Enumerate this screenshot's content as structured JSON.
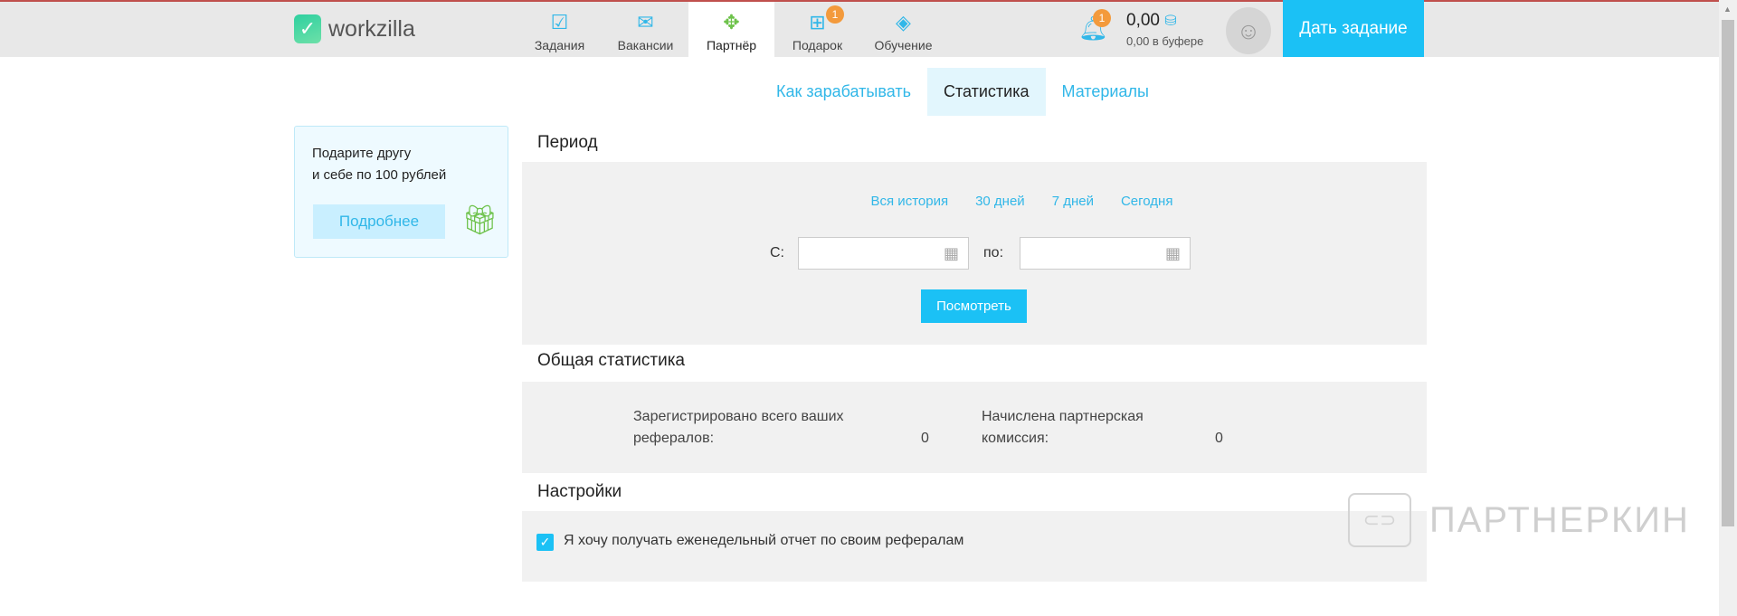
{
  "header": {
    "logo": "workzilla",
    "nav": [
      {
        "label": "Задания",
        "icon": "tasks-icon"
      },
      {
        "label": "Вакансии",
        "icon": "briefcase-icon"
      },
      {
        "label": "Партнёр",
        "icon": "handshake-icon",
        "active": true
      },
      {
        "label": "Подарок",
        "icon": "gift-icon",
        "badge": "1"
      },
      {
        "label": "Обучение",
        "icon": "graduation-cap-icon"
      }
    ],
    "notifications_badge": "1",
    "balance": "0,00",
    "buffer": "0,00 в буфере",
    "give_task": "Дать задание"
  },
  "subtabs": [
    {
      "label": "Как зарабатывать"
    },
    {
      "label": "Статистика",
      "active": true
    },
    {
      "label": "Материалы"
    }
  ],
  "promo": {
    "line1": "Подарите другу",
    "line2": "и себе по 100 рублей",
    "button": "Подробнее"
  },
  "period": {
    "title": "Период",
    "links": [
      "Вся история",
      "30 дней",
      "7 дней",
      "Сегодня"
    ],
    "from_label": "С:",
    "to_label": "по:",
    "from_value": "",
    "to_value": "",
    "button": "Посмотреть"
  },
  "stats": {
    "title": "Общая статистика",
    "registered_label": "Зарегистрировано всего ваших рефералов:",
    "registered_l1": "Зарегистрировано всего ваших",
    "registered_l2": "рефералов:",
    "registered_value": "0",
    "commission_l1": "Начислена партнерская",
    "commission_l2": "комиссия:",
    "commission_value": "0"
  },
  "settings": {
    "title": "Настройки",
    "weekly_report": "Я хочу получать еженедельный отчет по своим рефералам",
    "weekly_report_checked": true
  },
  "watermark": "ПАРТНЕРКИН",
  "colors": {
    "accent": "#1bc1f5",
    "green": "#6dc24a",
    "badge": "#f39a3c"
  }
}
